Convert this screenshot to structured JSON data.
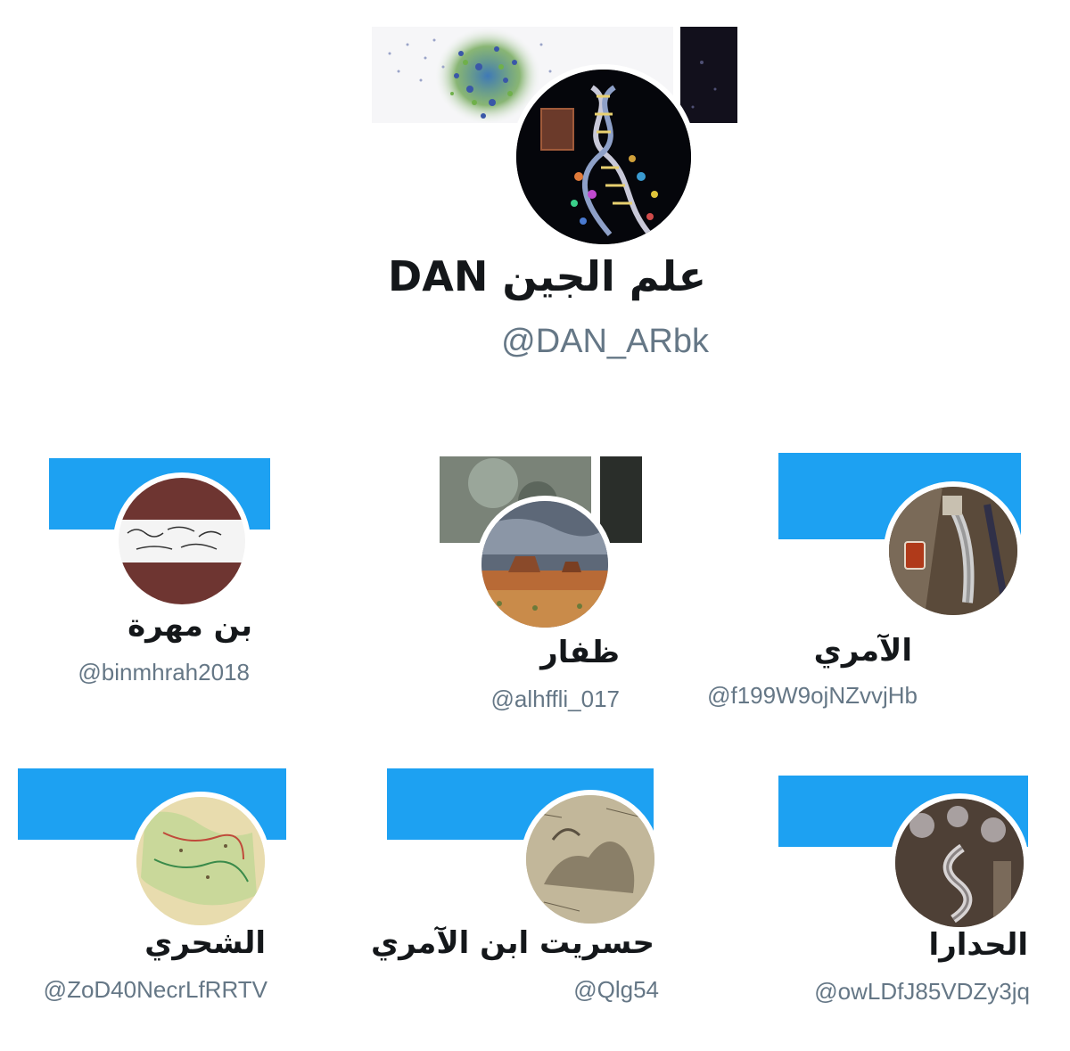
{
  "main_profile": {
    "name": "علم الجين DAN",
    "handle": "@DAN_ARbk",
    "avatar_icon": "dna-avatar-icon",
    "banner_icon": "dna-cells-banner-icon"
  },
  "accounts": [
    {
      "name": "بن مهرة",
      "handle": "@binmhrah2018",
      "avatar_icon": "flag-calligraphy-avatar-icon",
      "banner_color": "#1da1f2"
    },
    {
      "name": "ظفار",
      "handle": "@alhffli_017",
      "avatar_icon": "desert-landscape-avatar-icon",
      "banner_icon": "photo-banner-icon"
    },
    {
      "name": "الآمري",
      "handle": "@f199W9ojNZvvjHb",
      "avatar_icon": "dagger-tea-avatar-icon",
      "banner_color": "#1da1f2"
    },
    {
      "name": "الشحري",
      "handle": "@ZoD40NecrLfRRTV",
      "avatar_icon": "old-map-avatar-icon",
      "banner_color": "#1da1f2"
    },
    {
      "name": "حسريت ابن الآمري",
      "handle": "@Qlg54",
      "avatar_icon": "camel-sketch-avatar-icon",
      "banner_color": "#1da1f2"
    },
    {
      "name": "الحدارا",
      "handle": "@owLDfJ85VDZy3jq",
      "avatar_icon": "silver-jambiya-avatar-icon",
      "banner_color": "#1da1f2"
    }
  ]
}
